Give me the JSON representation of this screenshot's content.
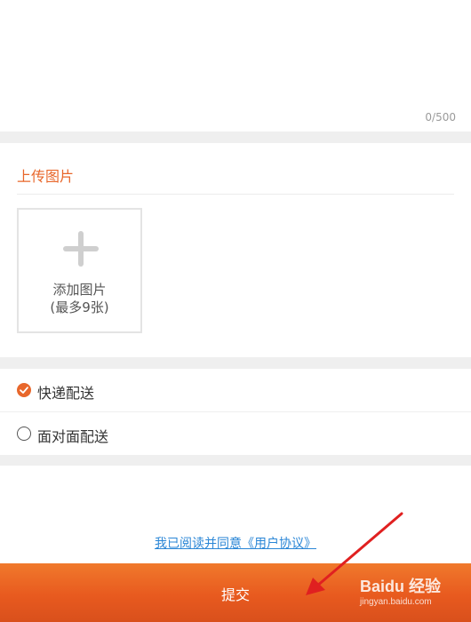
{
  "textarea": {
    "char_count": "0/500"
  },
  "upload": {
    "title": "上传图片",
    "add_photo_line1": "添加图片",
    "add_photo_line2": "(最多9张)"
  },
  "delivery_options": [
    {
      "label": "快递配送",
      "selected": true
    },
    {
      "label": "面对面配送",
      "selected": false
    }
  ],
  "agreement_link": "我已阅读并同意《用户协议》",
  "submit_label": "提交",
  "watermark": {
    "logo": "Baidu 经验",
    "url": "jingyan.baidu.com"
  },
  "colors": {
    "accent": "#e8672b",
    "link": "#2a86d6",
    "arrow": "#e02020"
  }
}
